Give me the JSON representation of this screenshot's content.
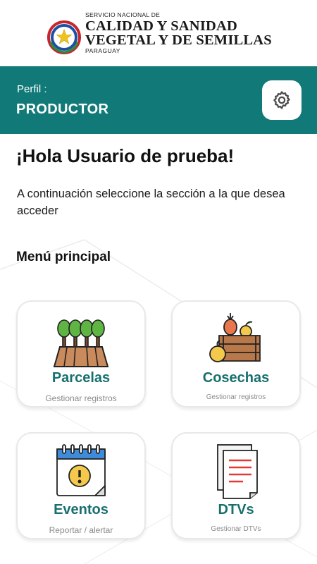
{
  "header": {
    "org_top": "SERVICIO NACIONAL DE",
    "org_line1": "CALIDAD Y SANIDAD",
    "org_line2": "VEGETAL Y DE SEMILLAS",
    "org_country": "PARAGUAY"
  },
  "profile": {
    "label": "Perfil :",
    "role": "PRODUCTOR",
    "settings_icon": "gear-icon"
  },
  "greeting": "¡Hola Usuario de prueba!",
  "instruction": "A continuación seleccione la sección a la que desea acceder",
  "menu": {
    "title": "Menú principal",
    "items": [
      {
        "label": "Parcelas",
        "sub": "Gestionar registros",
        "icon": "trees-field-icon"
      },
      {
        "label": "Cosechas",
        "sub": "Gestionar registros",
        "icon": "harvest-basket-icon"
      },
      {
        "label": "Eventos",
        "sub": "Reportar / alertar",
        "icon": "calendar-alert-icon"
      },
      {
        "label": "DTVs",
        "sub": "Gestionar DTVs",
        "icon": "documents-icon"
      }
    ]
  },
  "colors": {
    "primary": "#117a78",
    "label": "#17706e",
    "subtext": "#8a8a8a"
  }
}
